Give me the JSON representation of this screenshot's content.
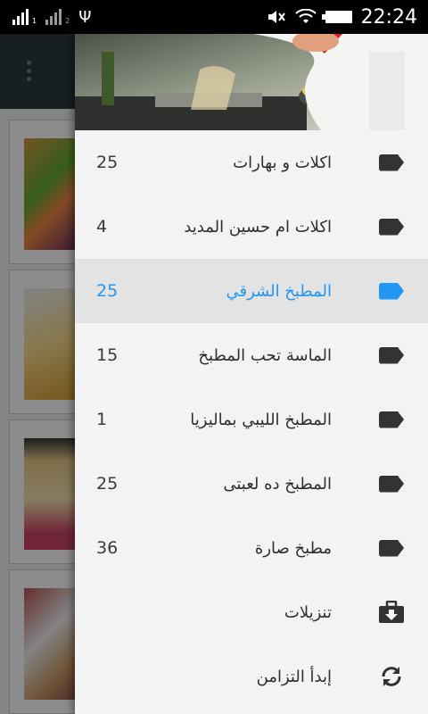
{
  "status_bar": {
    "time": "22:24",
    "sim1_label": "1",
    "sim2_label": "2",
    "icons": [
      "signal-icon",
      "signal-icon",
      "usb-icon",
      "mute-icon",
      "wifi-icon",
      "battery-icon"
    ]
  },
  "drawer": {
    "header_image": "chef-cooking-photo",
    "active_color": "#2196f3",
    "categories": [
      {
        "label": "اكلات و بهارات",
        "count": "25",
        "icon": "tag-icon",
        "active": false
      },
      {
        "label": "اكلات ام حسين المديد",
        "count": "4",
        "icon": "tag-icon",
        "active": false
      },
      {
        "label": "المطبخ الشرقي",
        "count": "25",
        "icon": "tag-icon",
        "active": true
      },
      {
        "label": "الماسة تحب المطبخ",
        "count": "15",
        "icon": "tag-icon",
        "active": false
      },
      {
        "label": "المطبخ الليبي بماليزيا",
        "count": "1",
        "icon": "tag-icon",
        "active": false
      },
      {
        "label": "المطبخ ده لعبتى",
        "count": "25",
        "icon": "tag-icon",
        "active": false
      },
      {
        "label": "مطبخ صارة",
        "count": "36",
        "icon": "tag-icon",
        "active": false
      }
    ],
    "actions": [
      {
        "label": "تنزيلات",
        "icon": "download-icon"
      },
      {
        "label": "إبدأ التزامن",
        "icon": "sync-icon"
      }
    ]
  }
}
